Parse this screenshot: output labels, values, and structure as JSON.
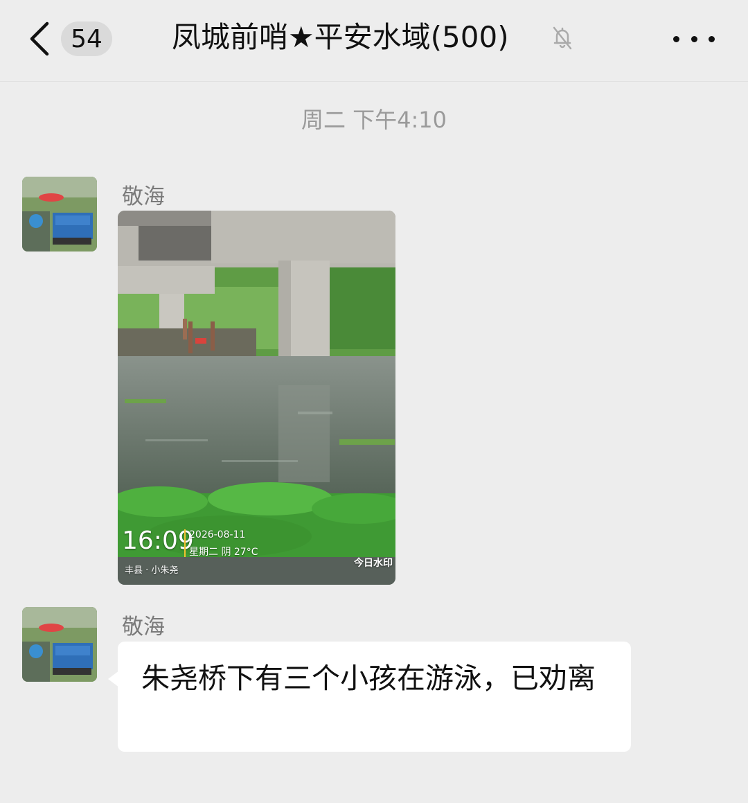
{
  "header": {
    "back_icon": "chevron-left-icon",
    "unread_count": "54",
    "title": "凤城前哨★平安水域(500)",
    "mute_icon": "bell-off-icon",
    "more_icon": "more-horizontal-icon"
  },
  "chat": {
    "time_divider": "周二 下午4:10",
    "messages": [
      {
        "sender": "敬海",
        "type": "image",
        "photo": {
          "time": "16:09",
          "date": "2026-08-11",
          "weather": "星期二 阴 27°C",
          "location": "丰县 · 小朱尧",
          "watermark": "今日水印"
        }
      },
      {
        "sender": "敬海",
        "type": "text",
        "text": "朱尧桥下有三个小孩在游泳，已劝离"
      }
    ]
  }
}
